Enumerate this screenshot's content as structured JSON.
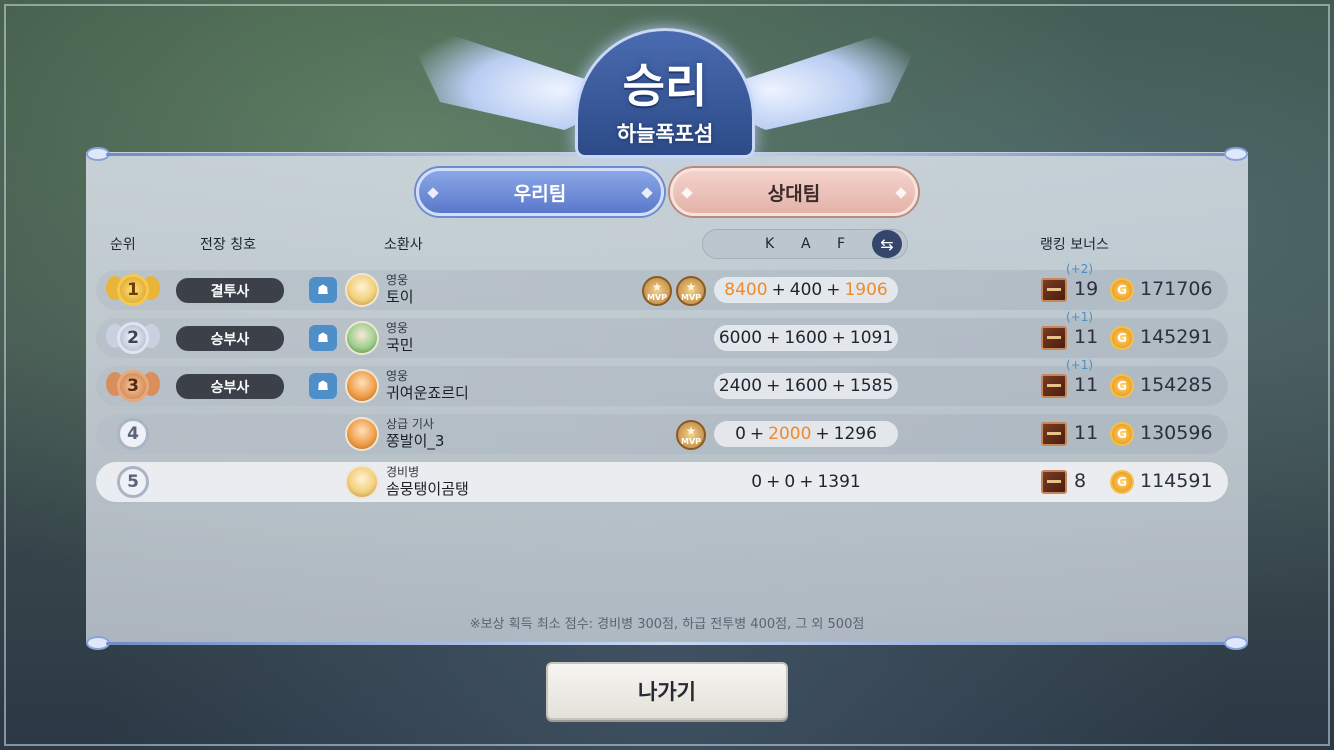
{
  "header": {
    "result": "승리",
    "map_name": "하늘폭포섬"
  },
  "tabs": {
    "our_team": "우리팀",
    "enemy_team": "상대팀",
    "selected": "enemy_team"
  },
  "columns": {
    "rank": "순위",
    "battle_title": "전장 칭호",
    "summoner": "소환사",
    "k": "K",
    "a": "A",
    "f": "F",
    "ranking_bonus": "랭킹 보너스"
  },
  "rows": [
    {
      "rank": "1",
      "badge": "gold",
      "title": "결투사",
      "party": true,
      "rank_label": "영웅",
      "name": "토이",
      "mvp_count": 2,
      "k": "8400",
      "a": "400",
      "f": "1906",
      "highlight": [
        "k",
        "f"
      ],
      "bonus_plus": "(+2)",
      "bonus": "19",
      "gold": "171706"
    },
    {
      "rank": "2",
      "badge": "silver",
      "title": "승부사",
      "party": true,
      "rank_label": "영웅",
      "name": "국민",
      "mvp_count": 0,
      "k": "6000",
      "a": "1600",
      "f": "1091",
      "highlight": [],
      "bonus_plus": "(+1)",
      "bonus": "11",
      "gold": "145291"
    },
    {
      "rank": "3",
      "badge": "bronze",
      "title": "승부사",
      "party": true,
      "rank_label": "영웅",
      "name": "귀여운죠르디",
      "mvp_count": 0,
      "k": "2400",
      "a": "1600",
      "f": "1585",
      "highlight": [],
      "bonus_plus": "(+1)",
      "bonus": "11",
      "gold": "154285"
    },
    {
      "rank": "4",
      "badge": "plain",
      "title": "",
      "party": false,
      "rank_label": "상급 기사",
      "name": "쫑발이_3",
      "mvp_count": 1,
      "k": "0",
      "a": "2000",
      "f": "1296",
      "highlight": [
        "a"
      ],
      "bonus_plus": "",
      "bonus": "11",
      "gold": "130596"
    },
    {
      "rank": "5",
      "badge": "plain",
      "title": "",
      "party": false,
      "rank_label": "경비병",
      "name": "솜뭉탱이곰탱",
      "mvp_count": 0,
      "k": "0",
      "a": "0",
      "f": "1391",
      "highlight": [],
      "bonus_plus": "",
      "bonus": "8",
      "gold": "114591"
    }
  ],
  "mvp_label": "MVP",
  "coin_glyph": "G",
  "notice": "※보상 획득 최소 점수: 경비병 300점, 하급 전투병 400점, 그 외 500점",
  "exit_button": "나가기",
  "colors": {
    "highlight": "#f08a2a",
    "our_tab": "#6f8ad6",
    "enemy_tab": "#e8bab0"
  }
}
